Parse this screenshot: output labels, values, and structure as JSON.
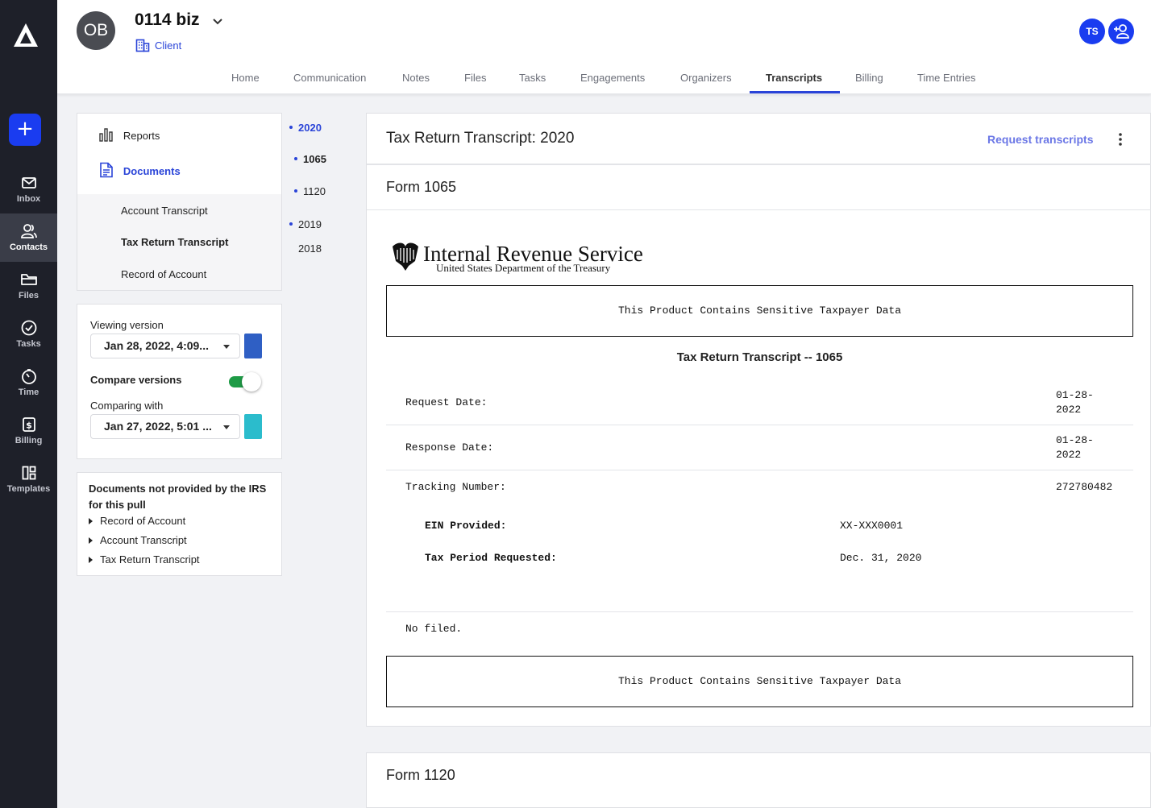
{
  "sidebar": {
    "add_label": "+",
    "items": [
      {
        "label": "Inbox",
        "icon": "mail-icon"
      },
      {
        "label": "Contacts",
        "icon": "contacts-icon",
        "active": true
      },
      {
        "label": "Files",
        "icon": "folder-icon"
      },
      {
        "label": "Tasks",
        "icon": "check-circle-icon"
      },
      {
        "label": "Time",
        "icon": "timer-icon"
      },
      {
        "label": "Billing",
        "icon": "billing-icon"
      },
      {
        "label": "Templates",
        "icon": "templates-icon"
      }
    ]
  },
  "header": {
    "avatar_initials": "OB",
    "client_name": "0114 biz",
    "client_type": "Client",
    "user_initials": "TS",
    "tabs": [
      "Home",
      "Communication",
      "Notes",
      "Files",
      "Tasks",
      "Engagements",
      "Organizers",
      "Transcripts",
      "Billing",
      "Time Entries"
    ],
    "active_tab": "Transcripts"
  },
  "left_panel": {
    "reports_label": "Reports",
    "documents_label": "Documents",
    "doc_links": [
      "Account Transcript",
      "Tax Return Transcript",
      "Record of Account"
    ],
    "active_doc": "Tax Return Transcript"
  },
  "version_panel": {
    "viewing_label": "Viewing version",
    "viewing_value": "Jan 28, 2022, 4:09...",
    "viewing_color": "#2f5fc4",
    "compare_label": "Compare versions",
    "compare_on": true,
    "comparing_label": "Comparing with",
    "comparing_value": "Jan 27, 2022, 5:01 ...",
    "comparing_color": "#2bbccc"
  },
  "not_provided": {
    "title": "Documents not provided by the IRS for this pull",
    "items": [
      "Record of Account",
      "Account Transcript",
      "Tax Return Transcript"
    ]
  },
  "years": [
    {
      "label": "2020",
      "active": true,
      "forms": [
        {
          "label": "1065",
          "active": true
        },
        {
          "label": "1120"
        }
      ]
    },
    {
      "label": "2019"
    },
    {
      "label": "2018"
    }
  ],
  "main": {
    "title": "Tax Return Transcript: 2020",
    "request_link": "Request transcripts",
    "form_title": "Form 1065",
    "irs_name": "Internal Revenue Service",
    "irs_sub": "United States Department of the Treasury",
    "sensitive_text": "This Product Contains Sensitive Taxpayer Data",
    "transcript_heading": "Tax Return Transcript -- 1065",
    "request_date_label": "Request Date:",
    "request_date_line1": "01-28-",
    "request_date_line2": "2022",
    "response_date_label": "Response Date:",
    "response_date_line1": "01-28-",
    "response_date_line2": "2022",
    "tracking_label": "Tracking Number:",
    "tracking_value": "272780482",
    "ein_label": "EIN Provided:",
    "ein_value": "XX-XXX0001",
    "period_label": "Tax Period Requested:",
    "period_value": "Dec. 31, 2020",
    "no_filed": "No filed.",
    "next_form_title": "Form 1120"
  }
}
